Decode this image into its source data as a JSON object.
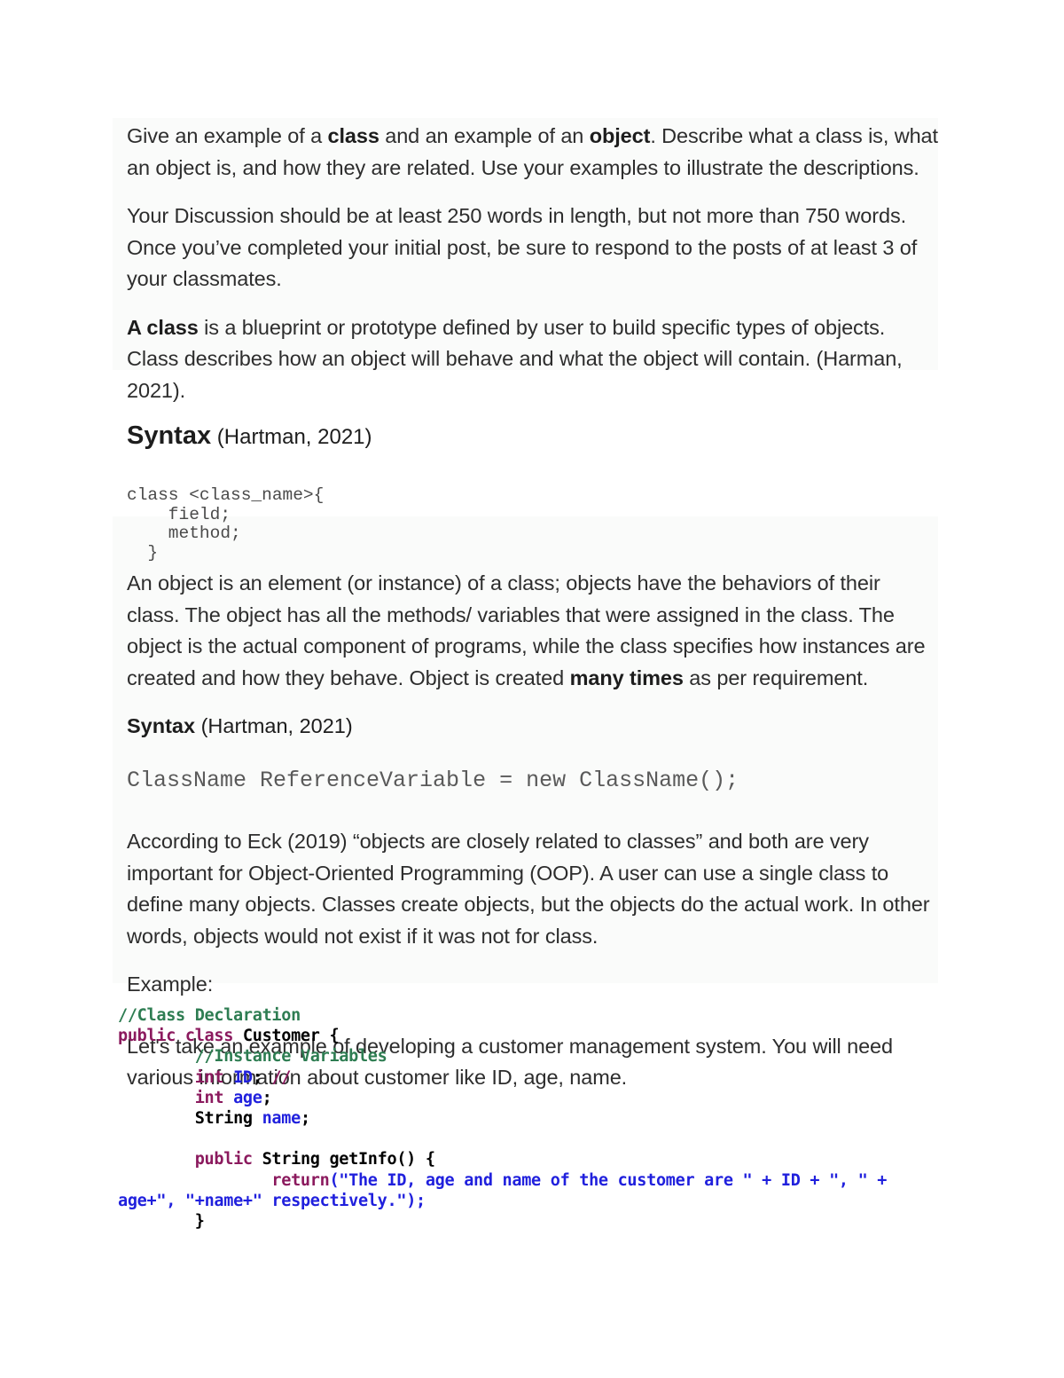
{
  "document": {
    "type": "discussion-post",
    "background_color": "#ffffff",
    "shade_color": "#fafbfa",
    "body_text_color": "#2d2d2d"
  },
  "prompt": {
    "paragraph_1": {
      "part_1": "Give an example of a ",
      "bold_1": "class",
      "part_2": " and an example of an ",
      "bold_2": "object",
      "part_3": ". Describe what a class is, what an object is, and how they are related. Use your examples to illustrate the descriptions."
    },
    "paragraph_2": "Your Discussion should be at least 250 words in length, but not more than 750 words. Once you’ve completed your initial post, be sure to respond to the posts of at least 3 of your classmates."
  },
  "class_section": {
    "definition": {
      "bold_lead": "A class",
      "rest": " is a blueprint or prototype defined by user to build specific types of objects. Class describes how an object will behave and what the object will contain. (Harman, 2021)."
    },
    "heading": {
      "keyword": "Syntax",
      "citation": " (Hartman, 2021)"
    },
    "code": "class <class_name>{\n    field;\n    method;\n  }"
  },
  "object_section": {
    "definition": {
      "part_1": "An object is an element (or instance) of a class; objects have the behaviors of their class. The object has all the methods/ variables that were assigned in the class. The object is the actual component of programs, while the class specifies how instances are created and how they behave. Object is created ",
      "bold_1": "many times",
      "part_2": " as per requirement."
    },
    "heading": {
      "keyword": "Syntax",
      "citation": " (Hartman, 2021)"
    },
    "code": "ClassName ReferenceVariable = new ClassName();"
  },
  "relation_section": {
    "paragraph": "According to Eck (2019) “objects are closely related to classes” and both are very important for Object-Oriented Programming (OOP). A user can use a single class to define many objects. Classes create objects, but the objects do the actual work. In other words, objects would not exist if it was not for class.",
    "example_label": "Example:",
    "example_intro": "Let's take an example of developing a customer management system. You will need various information about customer like ID, age, name."
  },
  "java_code": {
    "colors": {
      "comment": "#2e7d52",
      "keyword": "#8b1a5e",
      "type": "#000000",
      "variable": "#2020dd",
      "string": "#2020dd"
    },
    "lines": [
      {
        "tokens": [
          {
            "t": "//Class Declaration",
            "c": "cmt"
          }
        ]
      },
      {
        "tokens": [
          {
            "t": "public class ",
            "c": "kw"
          },
          {
            "t": "Customer {",
            "c": "typ"
          }
        ]
      },
      {
        "tokens": [
          {
            "t": "        ",
            "c": "pun"
          },
          {
            "t": "//Instance Variables",
            "c": "cmt"
          }
        ]
      },
      {
        "tokens": [
          {
            "t": "        ",
            "c": "pun"
          },
          {
            "t": "int ",
            "c": "kw"
          },
          {
            "t": "ID",
            "c": "var"
          },
          {
            "t": "; ",
            "c": "typ"
          },
          {
            "t": "//",
            "c": "kw"
          }
        ]
      },
      {
        "tokens": [
          {
            "t": "        ",
            "c": "pun"
          },
          {
            "t": "int ",
            "c": "kw"
          },
          {
            "t": "age",
            "c": "var"
          },
          {
            "t": ";",
            "c": "typ"
          }
        ]
      },
      {
        "tokens": [
          {
            "t": "        ",
            "c": "pun"
          },
          {
            "t": "String ",
            "c": "typ"
          },
          {
            "t": "name",
            "c": "var"
          },
          {
            "t": ";",
            "c": "typ"
          }
        ]
      },
      {
        "tokens": []
      },
      {
        "tokens": [
          {
            "t": "        ",
            "c": "pun"
          },
          {
            "t": "public ",
            "c": "kw"
          },
          {
            "t": "String getInfo() {",
            "c": "typ"
          }
        ]
      },
      {
        "tokens": [
          {
            "t": "                ",
            "c": "pun"
          },
          {
            "t": "return",
            "c": "kw"
          },
          {
            "t": "(",
            "c": "var"
          },
          {
            "t": "\"The ID, age and name of the customer are \"",
            "c": "str"
          },
          {
            "t": " + ",
            "c": "var"
          },
          {
            "t": "ID",
            "c": "var"
          },
          {
            "t": " + ",
            "c": "var"
          },
          {
            "t": "\", \"",
            "c": "str"
          },
          {
            "t": " + ",
            "c": "var"
          },
          {
            "t": "age",
            "c": "var"
          },
          {
            "t": "+",
            "c": "var"
          },
          {
            "t": "\", \"",
            "c": "str"
          },
          {
            "t": "+",
            "c": "var"
          },
          {
            "t": "name",
            "c": "var"
          },
          {
            "t": "+",
            "c": "var"
          },
          {
            "t": "\" respectively.\"",
            "c": "str"
          },
          {
            "t": ")",
            "c": "var"
          },
          {
            "t": ";",
            "c": "var"
          }
        ]
      },
      {
        "tokens": [
          {
            "t": "        }",
            "c": "typ"
          }
        ]
      }
    ]
  }
}
